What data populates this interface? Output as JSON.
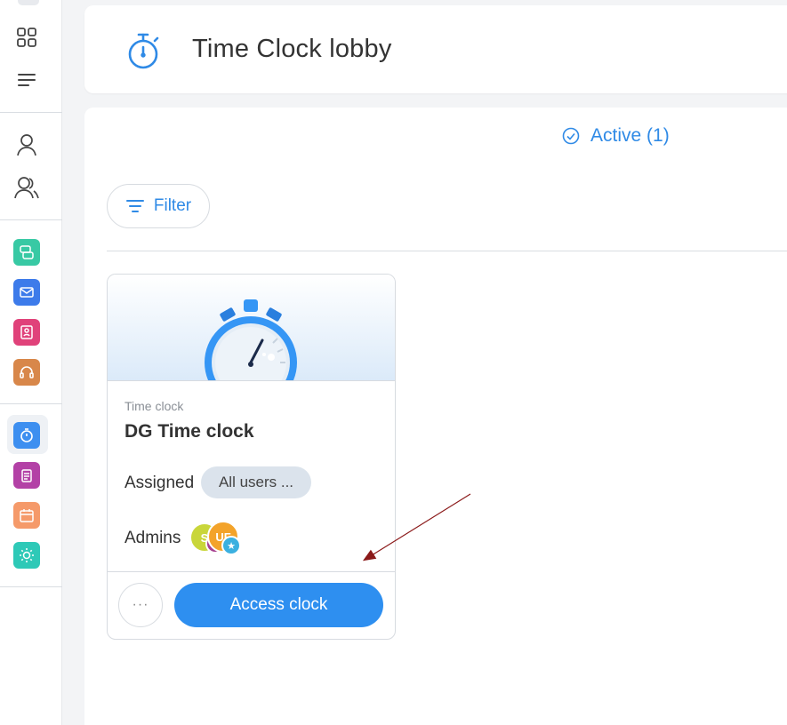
{
  "header": {
    "title": "Time Clock lobby",
    "icon": "stopwatch-icon"
  },
  "tabs": {
    "active_label": "Active (1)"
  },
  "filter": {
    "label": "Filter"
  },
  "card": {
    "type": "Time clock",
    "title": "DG Time clock",
    "assigned_label": "Assigned",
    "assigned_value": "All users ...",
    "admins_label": "Admins",
    "admins": [
      {
        "initials": "S",
        "color": "#c9d63a"
      },
      {
        "initials": "UF",
        "color": "#f3a32a"
      }
    ],
    "more_label": "···",
    "action_label": "Access clock"
  },
  "colors": {
    "accent": "#2e8ff0",
    "sidebar_apps": [
      "#38c9a4",
      "#3d7bea",
      "#e0427a",
      "#d8874a",
      "#3d8ff0",
      "#b341a6",
      "#f59a6a",
      "#2ec9b7"
    ]
  }
}
